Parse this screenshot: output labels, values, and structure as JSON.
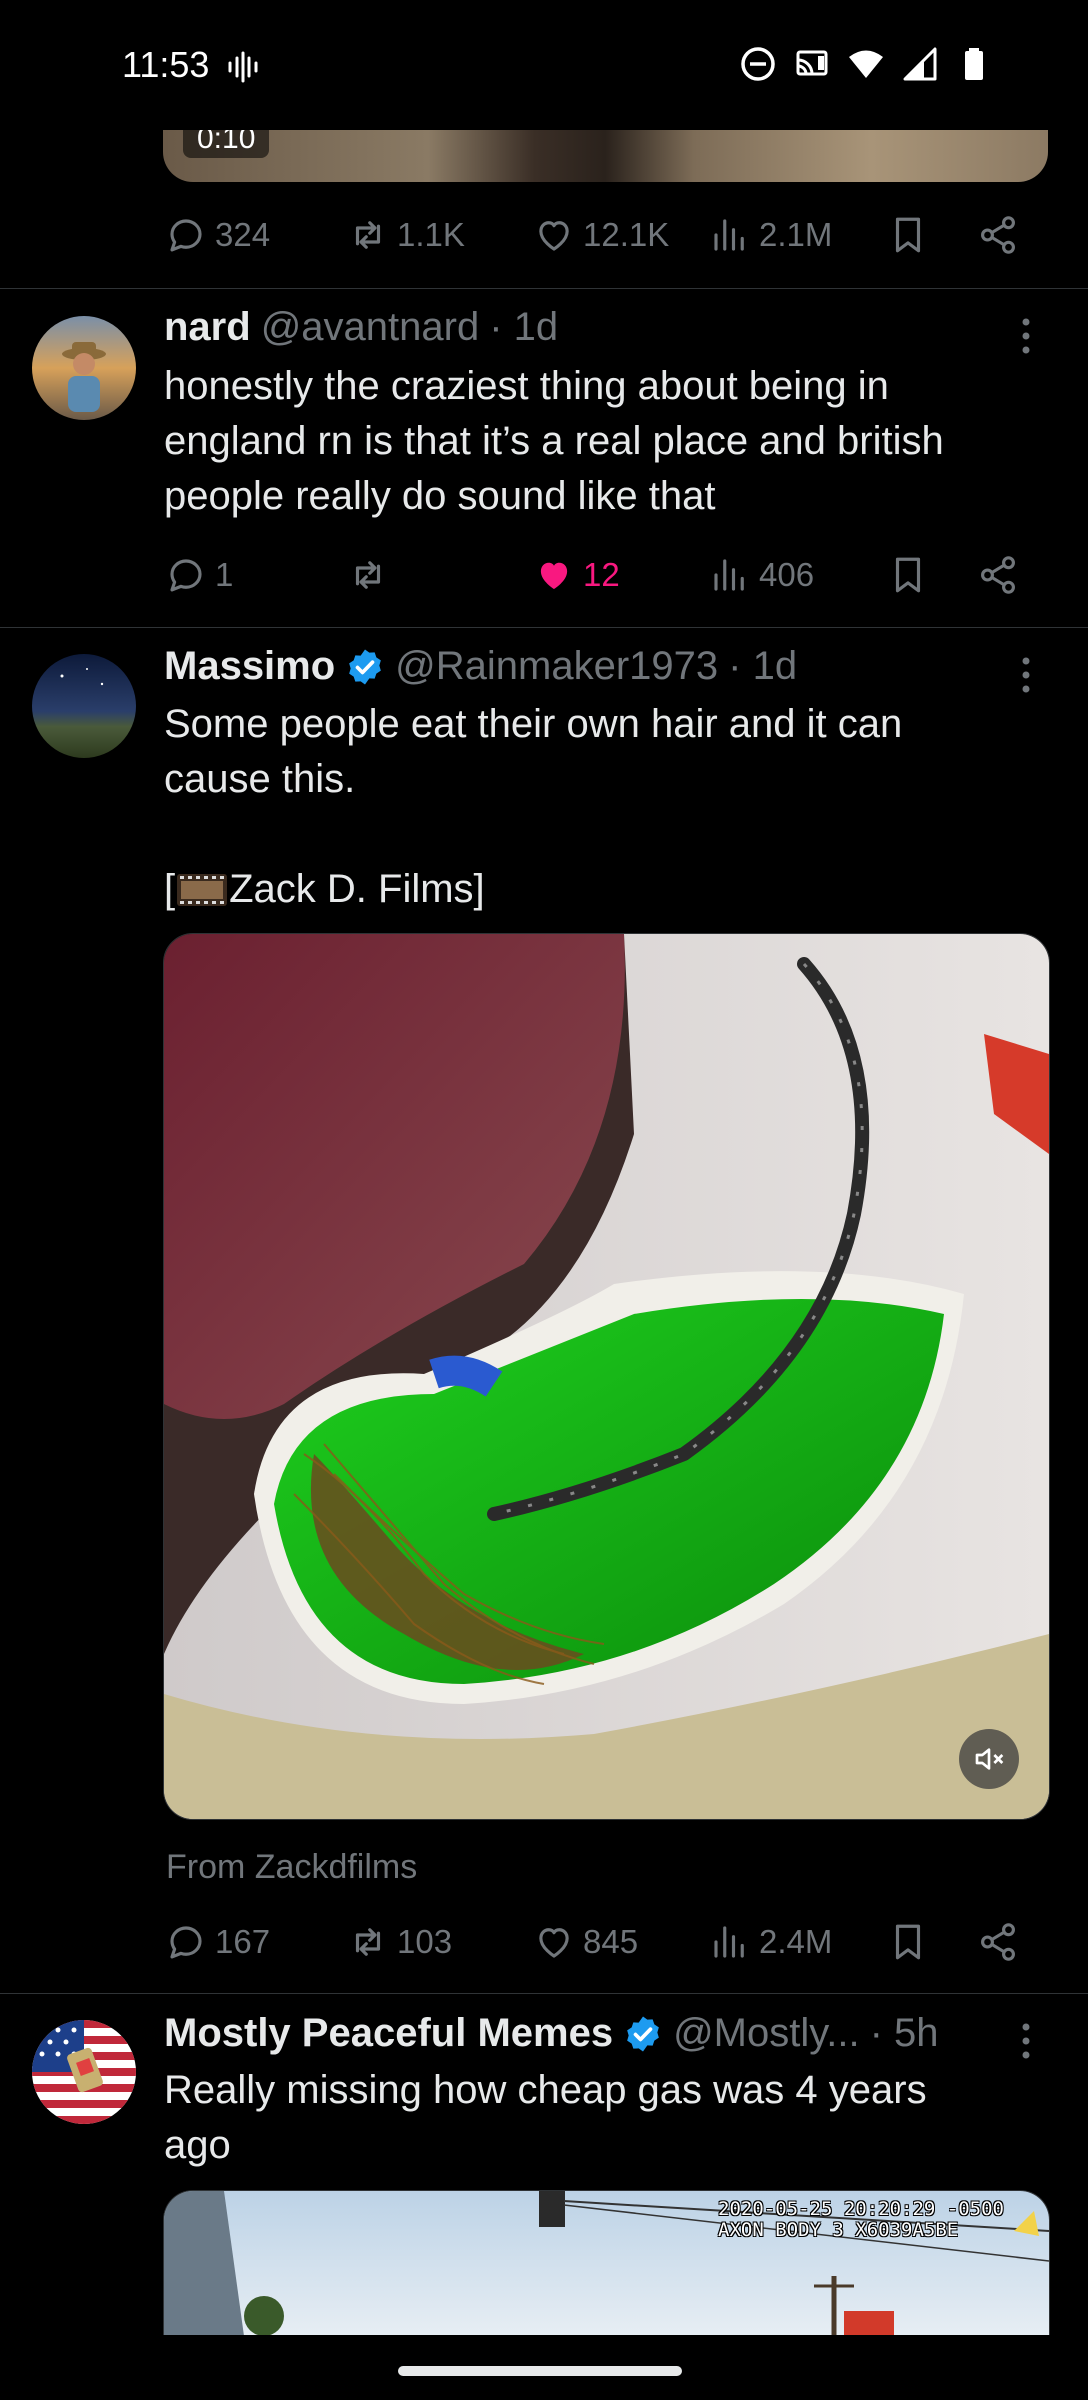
{
  "status_bar": {
    "time": "11:53"
  },
  "top_post": {
    "video_duration": "0:10",
    "replies": "324",
    "reposts": "1.1K",
    "likes": "12.1K",
    "views": "2.1M"
  },
  "posts": [
    {
      "name": "nard",
      "handle": "@avantnard",
      "time": "· 1d",
      "lines": [
        "honestly the craziest thing about being in",
        "england rn is that it’s a real place and british",
        "people really do sound like that"
      ],
      "replies": "1",
      "reposts": "",
      "likes": "12",
      "views": "406",
      "liked": true
    },
    {
      "name": "Massimo",
      "handle": "@Rainmaker1973",
      "time": "· 1d",
      "verified": true,
      "lines": [
        "Some people eat their own hair and it can",
        "cause this."
      ],
      "credit_prefix": "[",
      "credit_text": " Zack D. Films]",
      "from": "From Zackdfilms",
      "replies": "167",
      "reposts": "103",
      "likes": "845",
      "views": "2.4M",
      "liked": false
    },
    {
      "name": "Mostly Peaceful Memes",
      "handle": "@Mostly...",
      "time": "· 5h",
      "verified": true,
      "lines": [
        "Really missing how cheap gas was 4 years",
        "ago"
      ],
      "video_overlay": [
        "2020-05-25 20:20:29 -0500",
        "AXON BODY 3 X6039A5BE"
      ]
    }
  ],
  "colors": {
    "background": "#000000",
    "text": "#e7e9ea",
    "muted": "#71767b",
    "like": "#f91880",
    "verified": "#1d9bf0"
  }
}
